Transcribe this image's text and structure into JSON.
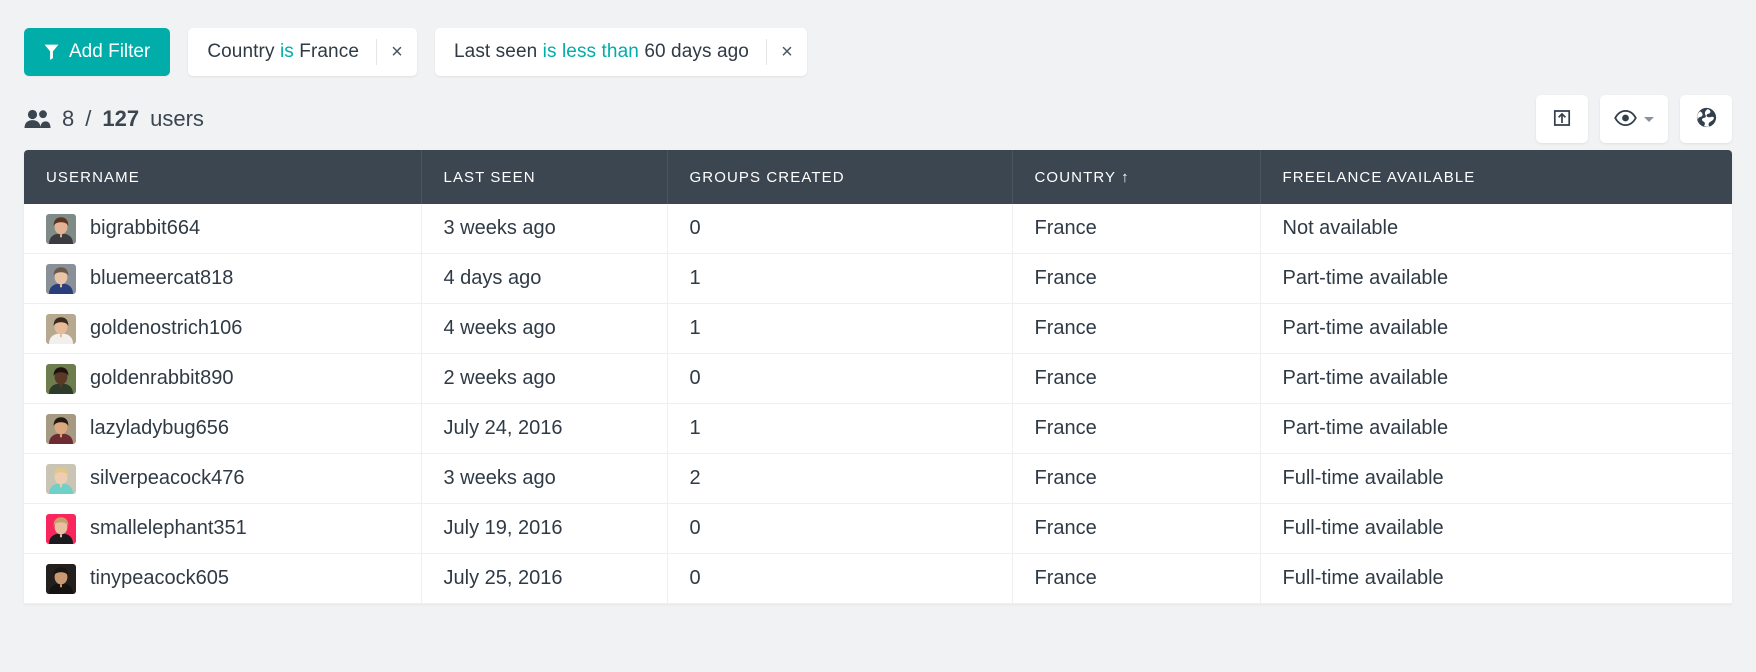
{
  "filter_bar": {
    "add_filter_label": "Add Filter",
    "chips": [
      {
        "field": "Country",
        "operator": "is",
        "value": "France",
        "close_label": "×"
      },
      {
        "field": "Last seen",
        "operator": "is less than",
        "value": "60 days ago",
        "close_label": "×"
      }
    ]
  },
  "summary": {
    "shown_count": "8",
    "separator": "/",
    "total_count": "127",
    "units_label": "users",
    "people_icon": "people-icon"
  },
  "actions": [
    {
      "name": "export-button",
      "icon": "export-box-arrow-up-icon",
      "label": "",
      "has_caret": false
    },
    {
      "name": "visibility-button",
      "icon": "eye-icon",
      "label": "",
      "has_caret": true
    },
    {
      "name": "globe-button",
      "icon": "globe-icon",
      "label": "",
      "has_caret": false
    }
  ],
  "table": {
    "columns": [
      {
        "label": "USERNAME",
        "sort": ""
      },
      {
        "label": "LAST SEEN",
        "sort": ""
      },
      {
        "label": "GROUPS CREATED",
        "sort": ""
      },
      {
        "label": "COUNTRY",
        "sort": "↑"
      },
      {
        "label": "FREELANCE AVAILABLE",
        "sort": ""
      }
    ],
    "rows": [
      {
        "username": "bigrabbit664",
        "last_seen": "3 weeks ago",
        "groups_created": "0",
        "country": "France",
        "freelance": "Not available",
        "avatar": {
          "bg": "#7f8b86",
          "skin": "#e3b295",
          "hair": "#5a3524",
          "shirt": "#3c3b42"
        }
      },
      {
        "username": "bluemeercat818",
        "last_seen": "4 days ago",
        "groups_created": "1",
        "country": "France",
        "freelance": "Part-time available",
        "avatar": {
          "bg": "#8a9098",
          "skin": "#e8c4a8",
          "hair": "#6b5a4a",
          "shirt": "#2a3f7a"
        }
      },
      {
        "username": "goldenostrich106",
        "last_seen": "4 weeks ago",
        "groups_created": "1",
        "country": "France",
        "freelance": "Part-time available",
        "avatar": {
          "bg": "#b7a98f",
          "skin": "#e7bb9a",
          "hair": "#3b2b1e",
          "shirt": "#f2f0ec"
        }
      },
      {
        "username": "goldenrabbit890",
        "last_seen": "2 weeks ago",
        "groups_created": "0",
        "country": "France",
        "freelance": "Part-time available",
        "avatar": {
          "bg": "#6e7d4e",
          "skin": "#5a3a26",
          "hair": "#1d1410",
          "shirt": "#2e3a2a"
        }
      },
      {
        "username": "lazyladybug656",
        "last_seen": "July 24, 2016",
        "groups_created": "1",
        "country": "France",
        "freelance": "Part-time available",
        "avatar": {
          "bg": "#a79a82",
          "skin": "#dba880",
          "hair": "#251a12",
          "shirt": "#6d2b33"
        }
      },
      {
        "username": "silverpeacock476",
        "last_seen": "3 weeks ago",
        "groups_created": "2",
        "country": "France",
        "freelance": "Full-time available",
        "avatar": {
          "bg": "#c9c4b4",
          "skin": "#f0cdb0",
          "hair": "#e0c88a",
          "shirt": "#6fd0c8"
        }
      },
      {
        "username": "smallelephant351",
        "last_seen": "July 19, 2016",
        "groups_created": "0",
        "country": "France",
        "freelance": "Full-time available",
        "avatar": {
          "bg": "#f8265c",
          "skin": "#e8bfa0",
          "hair": "#c9a06a",
          "shirt": "#1b1b1f"
        }
      },
      {
        "username": "tinypeacock605",
        "last_seen": "July 25, 2016",
        "groups_created": "0",
        "country": "France",
        "freelance": "Full-time available",
        "avatar": {
          "bg": "#221f1d",
          "skin": "#c99a72",
          "hair": "#1a1614",
          "shirt": "#141312"
        }
      }
    ]
  },
  "colors": {
    "accent_teal": "#00ada9",
    "header_dark": "#3b4651",
    "page_bg": "#f1f2f3",
    "text_dark": "#2f3a45"
  }
}
